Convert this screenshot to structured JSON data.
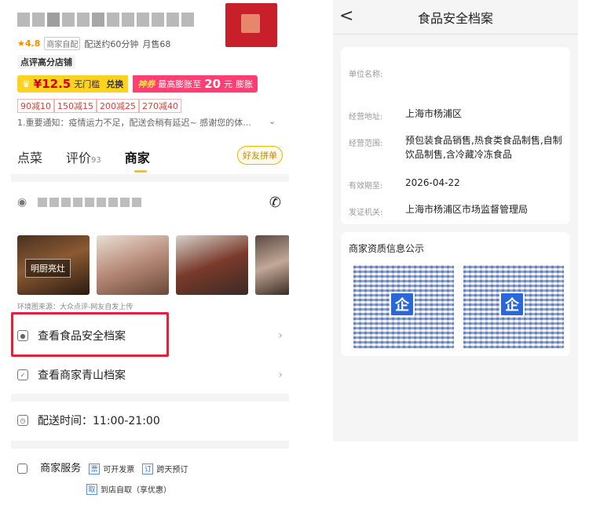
{
  "left": {
    "meta": {
      "rating": "★4.8",
      "tag": "商家自配",
      "delivery": "配送约60分钟",
      "monthly_sales": "月售68"
    },
    "shop_badge": "点评高分店铺",
    "coupon": {
      "price": "¥12.5",
      "threshold": "无门槛",
      "exchange": "兑换",
      "shen": "神券",
      "max_label": "最高膨胀至",
      "max_value": "20",
      "unit": "元",
      "expand": "膨胀"
    },
    "discounts": [
      "90减10",
      "150减15",
      "200减25",
      "270减40"
    ],
    "notice": "1.重要通知：疫情运力不足，配送会稍有延迟~ 感谢您的体...",
    "notice_arrow": "⌄",
    "tabs": [
      {
        "label": "点菜",
        "count": ""
      },
      {
        "label": "评价",
        "count": "93"
      },
      {
        "label": "商家",
        "count": ""
      }
    ],
    "friend_button": "好友拼单",
    "photo_label": "明厨亮灶",
    "photo_source": "环境图来源：大众点评-网友自发上传",
    "rows": {
      "food_safety": "查看食品安全档案",
      "qingshan": "查看商家青山档案",
      "delivery_time": "配送时间：11:00-21:00"
    },
    "services": {
      "label": "商家服务",
      "items": [
        {
          "icon": "票",
          "label": "可开发票"
        },
        {
          "icon": "订",
          "label": "跨天预订"
        },
        {
          "icon": "取",
          "label": "到店自取（享优惠）"
        }
      ]
    },
    "highlight_color": "#e0223c"
  },
  "right": {
    "title": "食品安全档案",
    "back": "<",
    "fields": [
      {
        "label": "单位名称:",
        "value": ""
      },
      {
        "label": "经营地址:",
        "value": "上海市杨浦区"
      },
      {
        "label": "经营范围:",
        "value": "预包装食品销售,热食类食品制售,自制饮品制售,含冷藏冷冻食品"
      },
      {
        "label": "有效期至:",
        "value": "2026-04-22"
      },
      {
        "label": "发证机关:",
        "value": "上海市杨浦区市场监督管理局"
      }
    ],
    "qual_title": "商家资质信息公示",
    "qr_icon_text": "企"
  }
}
